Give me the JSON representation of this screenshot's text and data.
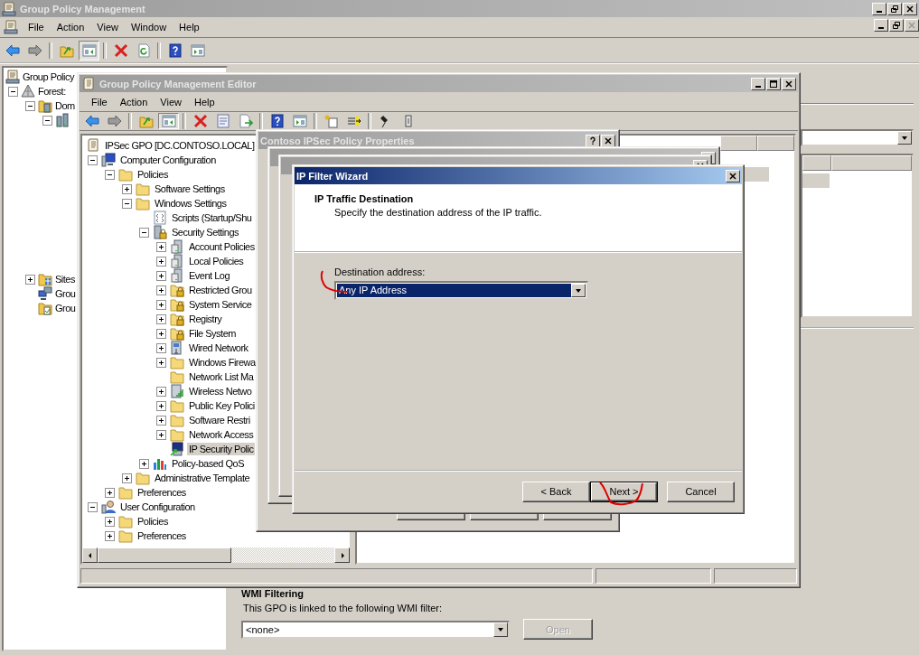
{
  "main_window": {
    "title": "Group Policy Management",
    "menu": [
      "File",
      "Action",
      "View",
      "Window",
      "Help"
    ],
    "tree": [
      {
        "label": "Group Policy",
        "kind": "gpm",
        "selected": false,
        "children": [
          {
            "label": "Forest:",
            "kind": "forest",
            "expanded": true,
            "selected": false,
            "children": [
              {
                "label": "Dom",
                "kind": "domains",
                "expanded": true,
                "selected": false,
                "children": [
                  {
                    "kind": "domain",
                    "expanded": true,
                    "selected": false
                  }
                ]
              },
              {
                "label": "Sites",
                "kind": "sites",
                "expanded": false,
                "selected": false
              },
              {
                "label": "Grou",
                "kind": "modeling",
                "selected": false
              },
              {
                "label": "Grou",
                "kind": "results",
                "selected": false
              }
            ]
          }
        ]
      }
    ],
    "wmi": {
      "heading": "WMI Filtering",
      "text": "This GPO is linked to the following WMI filter:",
      "value": "<none>",
      "button": {
        "label": "Open",
        "disabled": true
      }
    }
  },
  "editor": {
    "title": "Group Policy Management Editor",
    "menu": [
      "File",
      "Action",
      "View",
      "Help"
    ],
    "tree": [
      {
        "label": "IPSec GPO [DC.CONTOSO.LOCAL]",
        "kind": "gpo",
        "selected": false,
        "children": [
          {
            "label": "Computer Configuration",
            "kind": "computer",
            "expanded": true,
            "selected": false,
            "children": [
              {
                "label": "Policies",
                "kind": "folder",
                "expanded": true,
                "selected": false,
                "children": [
                  {
                    "label": "Software Settings",
                    "kind": "folder",
                    "expanded": false,
                    "selected": false
                  },
                  {
                    "label": "Windows Settings",
                    "kind": "folder",
                    "expanded": true,
                    "selected": false,
                    "children": [
                      {
                        "label": "Scripts (Startup/Shu",
                        "kind": "scripts",
                        "selected": false
                      },
                      {
                        "label": "Security Settings",
                        "kind": "security",
                        "expanded": true,
                        "selected": false,
                        "children": [
                          {
                            "label": "Account Policies",
                            "kind": "server",
                            "expanded": false,
                            "selected": false
                          },
                          {
                            "label": "Local Policies",
                            "kind": "server",
                            "expanded": false,
                            "selected": false
                          },
                          {
                            "label": "Event Log",
                            "kind": "server",
                            "expanded": false,
                            "selected": false
                          },
                          {
                            "label": "Restricted Grou",
                            "kind": "locked",
                            "expanded": false,
                            "selected": false
                          },
                          {
                            "label": "System Service",
                            "kind": "locked",
                            "expanded": false,
                            "selected": false
                          },
                          {
                            "label": "Registry",
                            "kind": "locked",
                            "expanded": false,
                            "selected": false
                          },
                          {
                            "label": "File System",
                            "kind": "locked",
                            "expanded": false,
                            "selected": false
                          },
                          {
                            "label": "Wired Network",
                            "kind": "network",
                            "expanded": false,
                            "selected": false
                          },
                          {
                            "label": "Windows Firewa",
                            "kind": "folder",
                            "expanded": false,
                            "selected": false
                          },
                          {
                            "label": "Network List Ma",
                            "kind": "folder",
                            "selected": false
                          },
                          {
                            "label": "Wireless Netwo",
                            "kind": "wireless",
                            "expanded": false,
                            "selected": false
                          },
                          {
                            "label": "Public Key Polici",
                            "kind": "folder",
                            "expanded": false,
                            "selected": false
                          },
                          {
                            "label": "Software Restri",
                            "kind": "folder",
                            "expanded": false,
                            "selected": false
                          },
                          {
                            "label": "Network Access",
                            "kind": "folder",
                            "expanded": false,
                            "selected": false
                          },
                          {
                            "label": "IP Security Polic",
                            "kind": "ipsec",
                            "selected": true
                          }
                        ]
                      },
                      {
                        "label": "Policy-based QoS",
                        "kind": "qos",
                        "expanded": false,
                        "selected": false
                      }
                    ]
                  },
                  {
                    "label": "Administrative Template",
                    "kind": "folder",
                    "expanded": false,
                    "selected": false
                  }
                ]
              },
              {
                "label": "Preferences",
                "kind": "folder",
                "expanded": false,
                "selected": false
              }
            ]
          },
          {
            "label": "User Configuration",
            "kind": "user",
            "expanded": true,
            "selected": false,
            "children": [
              {
                "label": "Policies",
                "kind": "folder",
                "expanded": false,
                "selected": false
              },
              {
                "label": "Preferences",
                "kind": "folder",
                "expanded": false,
                "selected": false
              }
            ]
          }
        ]
      }
    ]
  },
  "properties_dialog": {
    "title": "Contoso IPSec Policy Properties"
  },
  "wizard": {
    "title": "IP Filter Wizard",
    "heading": "IP Traffic Destination",
    "subheading": "Specify the destination address of the IP traffic.",
    "field_label": "Destination address:",
    "field_value": "Any IP Address",
    "buttons": [
      {
        "label": "< Back",
        "default": false
      },
      {
        "label": "Next >",
        "default": true
      },
      {
        "label": "Cancel",
        "default": false
      }
    ]
  }
}
